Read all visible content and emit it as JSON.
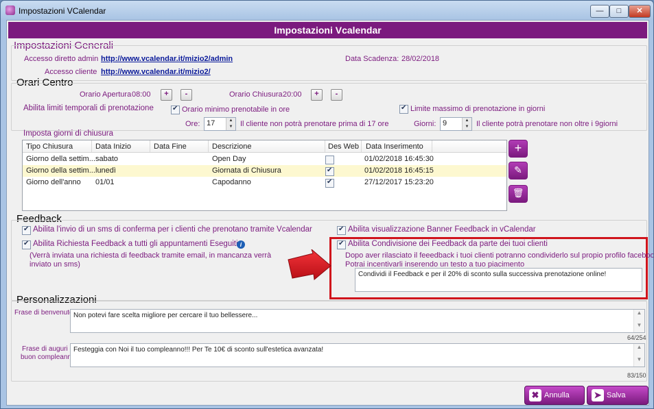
{
  "window": {
    "title": "Impostazioni VCalendar"
  },
  "banner": "Impostazioni Vcalendar",
  "general": {
    "heading": "Impostazioni Generali",
    "admin_label": "Accesso diretto admin",
    "admin_url": "http://www.vcalendar.it/mizio2/admin",
    "client_label": "Accesso cliente",
    "client_url": "http://www.vcalendar.it/mizio2/",
    "expiry_label": "Data Scadenza:",
    "expiry_value": "28/02/2018"
  },
  "hours": {
    "heading": "Orari Centro",
    "open_label": "Orario Apertura",
    "open_value": "08:00",
    "close_label": "Orario Chiusura",
    "close_value": "20:00",
    "plus": "+",
    "minus": "-",
    "limits_label": "Abilita limiti temporali di prenotazione",
    "min_check_label": "Orario minimo prenotabile in ore",
    "min_hours_label": "Ore:",
    "min_hours_value": "17",
    "min_hint": "Il cliente non potrà prenotare prima di 17 ore",
    "max_check_label": "Limite massimo di prenotazione in giorni",
    "max_days_label": "Giorni:",
    "max_days_value": "9",
    "max_hint": "Il cliente potrà prenotare non oltre i 9giorni"
  },
  "closures": {
    "heading": "Imposta giorni di chiusura",
    "columns": [
      "Tipo Chiusura",
      "Data Inizio",
      "Data Fine",
      "Descrizione",
      "Des Web",
      "Data Inserimento"
    ],
    "rows": [
      {
        "tipo": "Giorno della settim...",
        "inizio": "sabato",
        "fine": "",
        "descrizione": "Open Day",
        "desweb": false,
        "inserimento": "01/02/2018 16:45:30"
      },
      {
        "tipo": "Giorno della settim...",
        "inizio": "lunedì",
        "fine": "",
        "descrizione": "Giornata di Chiusura",
        "desweb": true,
        "inserimento": "01/02/2018 16:45:15"
      },
      {
        "tipo": "Giorno dell'anno",
        "inizio": "01/01",
        "fine": "",
        "descrizione": "Capodanno",
        "desweb": true,
        "inserimento": "27/12/2017 15:23:20"
      }
    ],
    "add_icon": "plus-icon",
    "edit_icon": "pencil-icon",
    "delete_icon": "trash-icon"
  },
  "feedback": {
    "heading": "Feedback",
    "sms_label": "Abilita l'invio di un sms di conferma per i clienti che prenotano tramite Vcalendar",
    "request_label": "Abilita Richiesta Feedback a tutti gli appuntamenti Eseguiti",
    "request_note_1": "(Verrà inviata una richiesta di feedback tramite email, in mancanza verrà",
    "request_note_2": "inviato un sms)",
    "banner_label": "Abilita visualizzazione Banner Feedback in vCalendar",
    "share_label": "Abilita Condivisione dei Feedback da parte dei tuoi clienti",
    "share_desc_1": "Dopo aver rilasciato il feeedback i tuoi clienti potranno condividerlo sul propio profilo facebook.",
    "share_desc_2": "Potrai incentivarli inserendo un testo a tuo piacimento",
    "share_text": "Condividi il Feedback e per il 20% di sconto sulla successiva prenotazione online!",
    "highlight_color": "#d0141c"
  },
  "personal": {
    "heading": "Personalizzazioni",
    "welcome_label": "Frase di benvenuto",
    "welcome_text": "Non potevi fare scelta migliore per cercare il tuo bellessere...",
    "welcome_count": "64/254",
    "birthday_label_1": "Frase di auguri di",
    "birthday_label_2": "buon compleanno",
    "birthday_text": "Festeggia con Noi il tuo compleanno!!! Per Te 10€ di sconto sull'estetica avanzata!",
    "birthday_count": "83/150"
  },
  "actions": {
    "cancel": "Annulla",
    "save": "Salva"
  },
  "colors": {
    "accent": "#7b1a7e"
  }
}
